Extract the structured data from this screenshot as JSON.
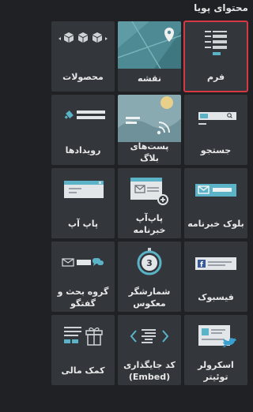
{
  "panel": {
    "title": "محتوای پویا"
  },
  "tiles": [
    {
      "label": "فرم",
      "icon": "form-icon",
      "selected": true
    },
    {
      "label": "نقشه",
      "icon": "map-icon",
      "selected": false
    },
    {
      "label": "محصولات",
      "icon": "products-icon",
      "selected": false
    },
    {
      "label": "جستجو",
      "icon": "search-icon",
      "selected": false
    },
    {
      "label": "پست‌های بلاگ",
      "icon": "blog-posts-icon",
      "selected": false
    },
    {
      "label": "رویدادها",
      "icon": "events-icon",
      "selected": false
    },
    {
      "label": "بلوک خبرنامه",
      "icon": "newsletter-block-icon",
      "selected": false
    },
    {
      "label": "پاپ‌آپ خبرنامه",
      "icon": "newsletter-popup-icon",
      "selected": false
    },
    {
      "label": "پاپ آپ",
      "icon": "popup-icon",
      "selected": false
    },
    {
      "label": "فیسبوک",
      "icon": "facebook-icon",
      "selected": false
    },
    {
      "label": "شمارشگر معکوس",
      "icon": "countdown-icon",
      "badge": "3",
      "selected": false
    },
    {
      "label": "گروه بحث و گفتگو",
      "icon": "discussion-icon",
      "selected": false
    },
    {
      "label": "اسکرولر توئیتر",
      "icon": "twitter-scroller-icon",
      "selected": false
    },
    {
      "label": "کد جایگذاری\n(Embed)",
      "icon": "embed-code-icon",
      "selected": false
    },
    {
      "label": "کمک مالی",
      "icon": "donation-icon",
      "selected": false
    }
  ]
}
